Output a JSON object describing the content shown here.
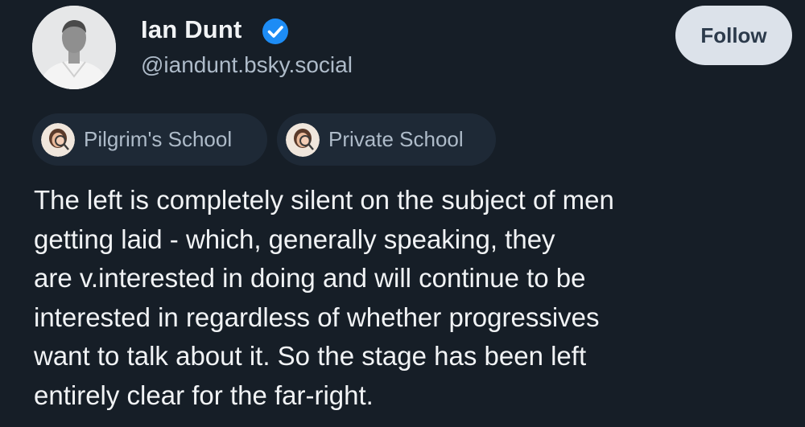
{
  "author": {
    "display_name": "Ian Dunt",
    "handle": "@iandunt.bsky.social",
    "verified": true
  },
  "follow_button": {
    "label": "Follow"
  },
  "feeds": [
    {
      "label": "Pilgrim's School",
      "icon": "feed-avatar-icon"
    },
    {
      "label": "Private School",
      "icon": "feed-avatar-icon"
    }
  ],
  "post": {
    "lines": [
      "The left is completely silent on the subject of men",
      "getting laid - which, generally speaking, they",
      "are v.interested in doing and will continue to be",
      "interested in regardless of whether progressives",
      "want to talk about it. So the stage has been left",
      "entirely clear for the far-right."
    ]
  },
  "colors": {
    "background": "#161e27",
    "verified_badge": "#1d8cf5",
    "follow_button_bg": "#dce2ea",
    "handle_text": "#aebbc9"
  }
}
